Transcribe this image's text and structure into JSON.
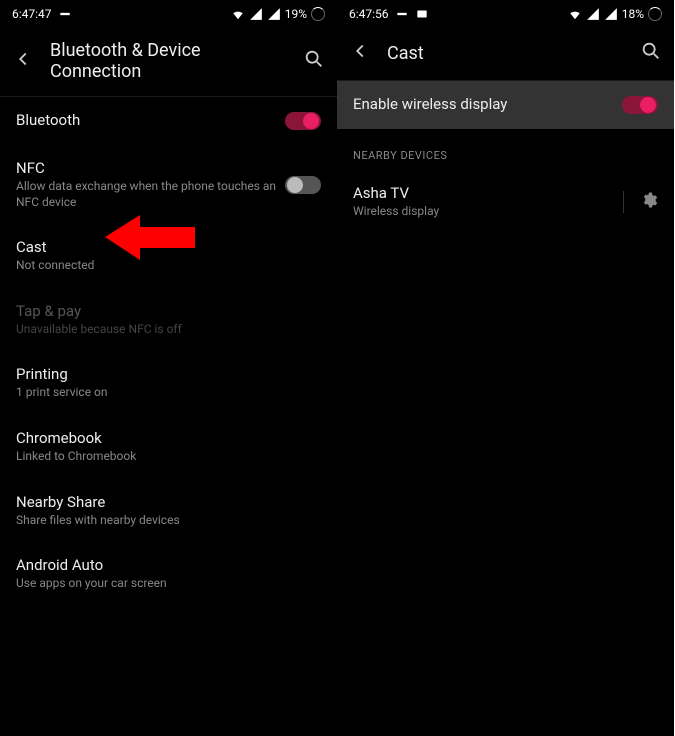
{
  "left": {
    "status": {
      "time": "6:47:47",
      "battery": "19%"
    },
    "header": {
      "title": "Bluetooth & Device Connection"
    },
    "items": {
      "bluetooth": {
        "title": "Bluetooth",
        "on": true
      },
      "nfc": {
        "title": "NFC",
        "sub": "Allow data exchange when the phone touches an NFC device",
        "on": false
      },
      "cast": {
        "title": "Cast",
        "sub": "Not connected"
      },
      "tappay": {
        "title": "Tap & pay",
        "sub": "Unavailable because NFC is off"
      },
      "printing": {
        "title": "Printing",
        "sub": "1 print service on"
      },
      "chromebook": {
        "title": "Chromebook",
        "sub": "Linked to Chromebook"
      },
      "nearby": {
        "title": "Nearby Share",
        "sub": "Share files with nearby devices"
      },
      "androidauto": {
        "title": "Android Auto",
        "sub": "Use apps on your car screen"
      }
    }
  },
  "right": {
    "status": {
      "time": "6:47:56",
      "battery": "18%"
    },
    "header": {
      "title": "Cast"
    },
    "enable": {
      "title": "Enable wireless display",
      "on": true
    },
    "section": "NEARBY DEVICES",
    "device": {
      "title": "Asha TV",
      "sub": "Wireless display"
    }
  }
}
